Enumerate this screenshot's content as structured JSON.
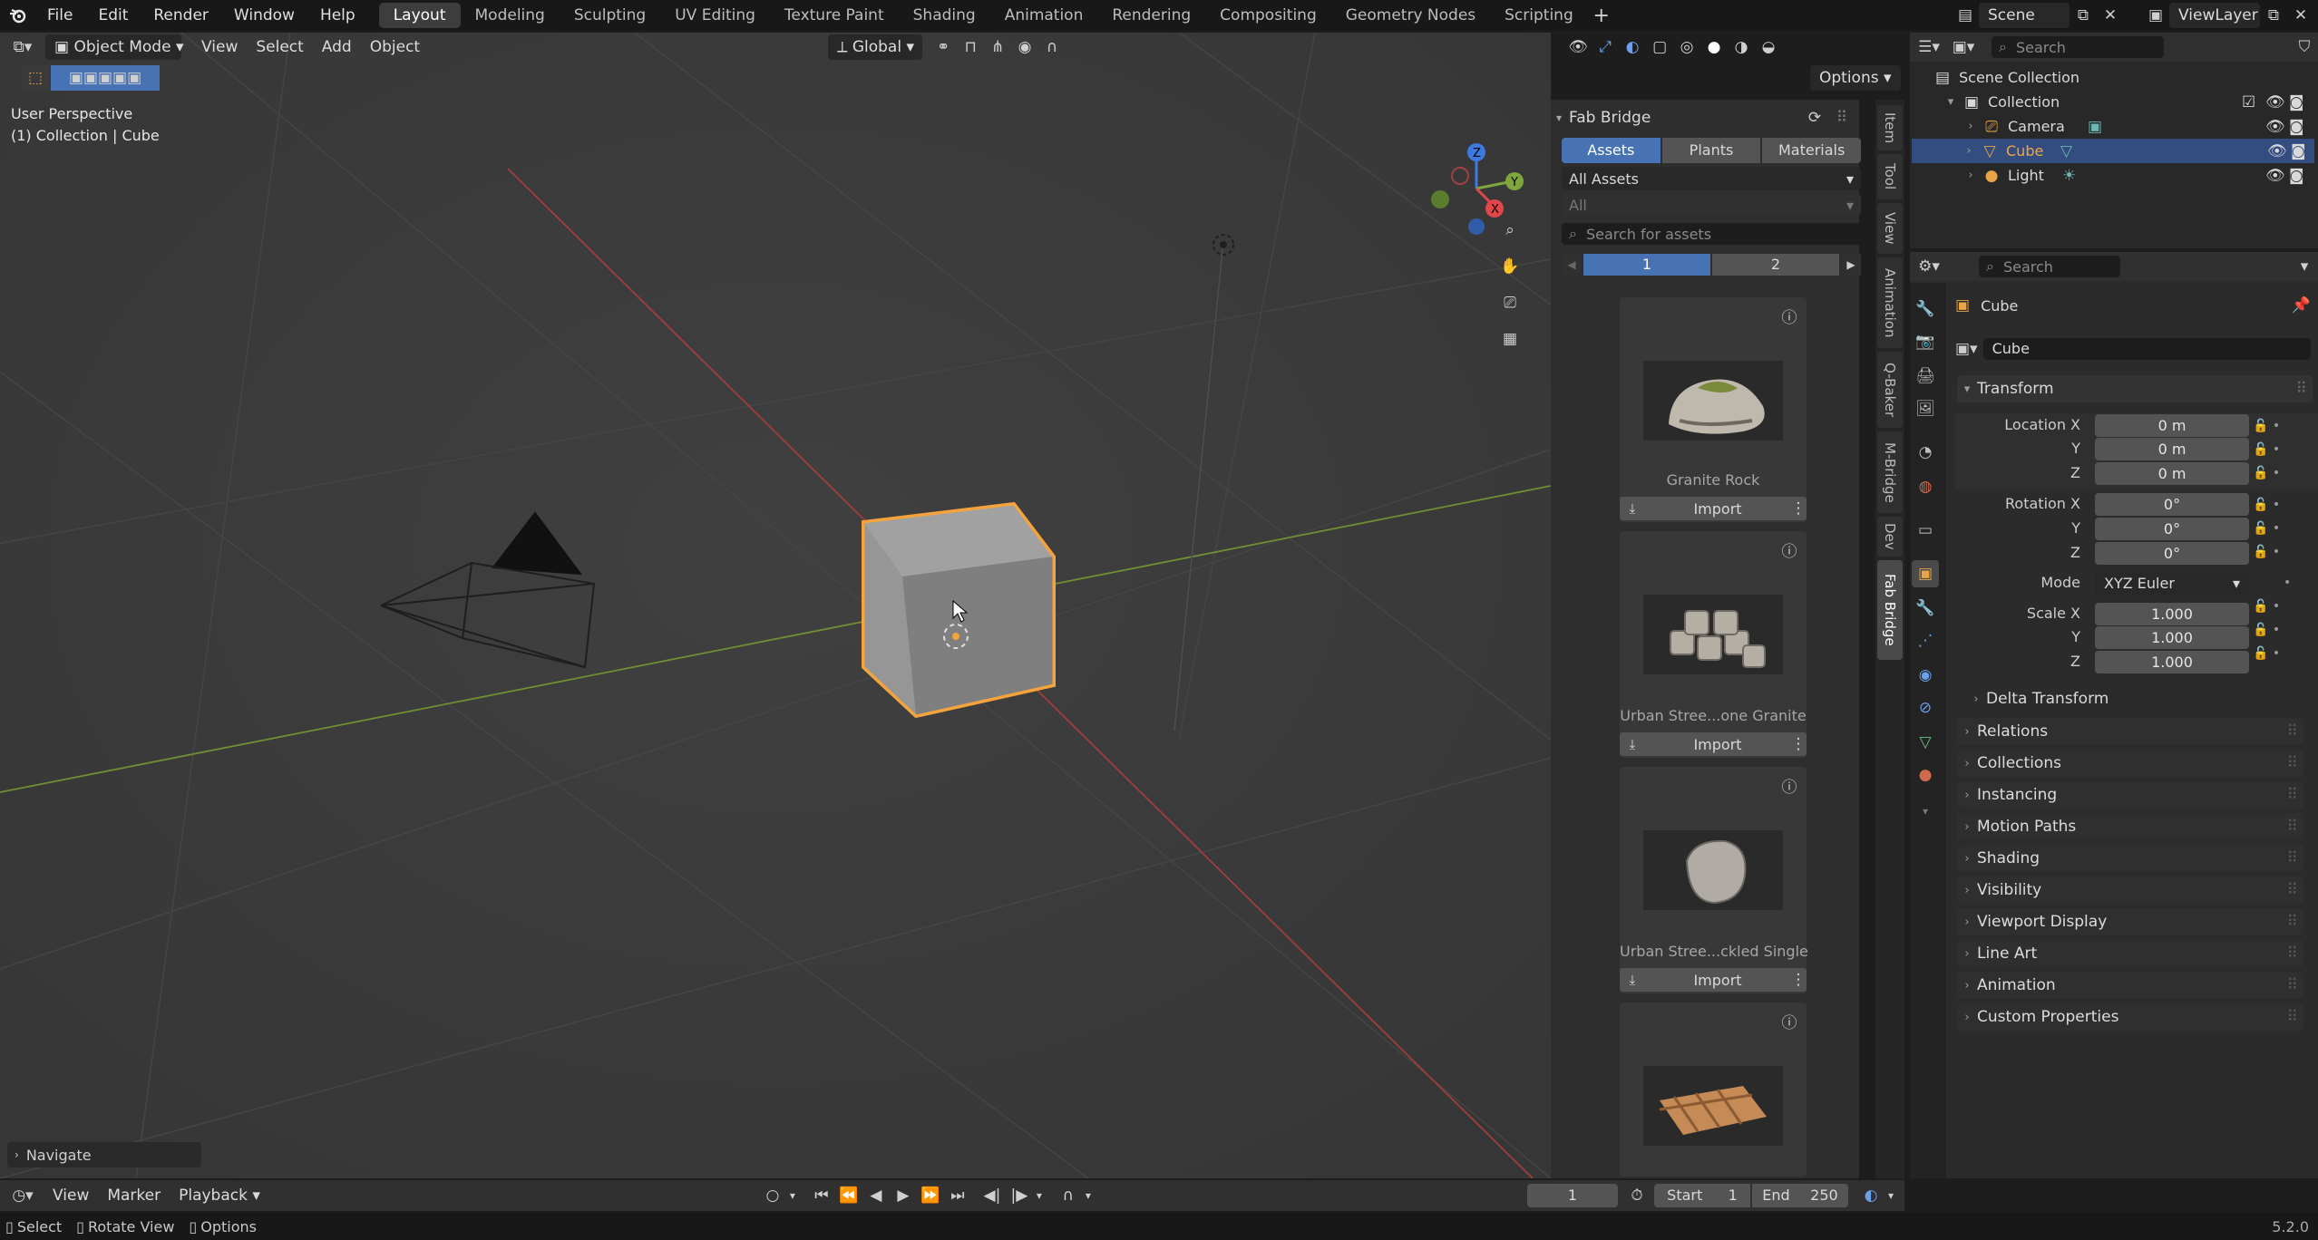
{
  "menu": {
    "items": [
      "File",
      "Edit",
      "Render",
      "Window",
      "Help"
    ]
  },
  "workspaces": [
    "Layout",
    "Modeling",
    "Sculpting",
    "UV Editing",
    "Texture Paint",
    "Shading",
    "Animation",
    "Rendering",
    "Compositing",
    "Geometry Nodes",
    "Scripting"
  ],
  "active_workspace": "Layout",
  "scene": {
    "name": "Scene",
    "view_layer": "ViewLayer"
  },
  "viewport": {
    "mode": "Object Mode",
    "menus": [
      "View",
      "Select",
      "Add",
      "Object"
    ],
    "orientation": "Global",
    "options_label": "Options",
    "info_line1": "User Perspective",
    "info_line2": "(1) Collection | Cube",
    "navigate_label": "Navigate"
  },
  "fab": {
    "title": "Fab Bridge",
    "tabs": [
      "Assets",
      "Plants",
      "Materials"
    ],
    "active_tab": "Assets",
    "filter": "All Assets",
    "subfilter": "All",
    "search_placeholder": "Search for assets",
    "pages": [
      "1",
      "2"
    ],
    "active_page": "1",
    "import_label": "Import",
    "assets": [
      {
        "name": "Granite Rock"
      },
      {
        "name": "Urban Stree...one Granite"
      },
      {
        "name": "Urban Stree...ckled Single"
      },
      {
        "name": ""
      }
    ]
  },
  "side_tabs": [
    "Item",
    "Tool",
    "View",
    "Animation",
    "Q-Baker",
    "M-Bridge",
    "Dev",
    "Fab Bridge"
  ],
  "outliner": {
    "search_placeholder": "Search",
    "root": "Scene Collection",
    "collection": "Collection",
    "objects": [
      "Camera",
      "Cube",
      "Light"
    ],
    "selected": "Cube"
  },
  "properties": {
    "search_placeholder": "Search",
    "object_name": "Cube",
    "data_name": "Cube",
    "transform_label": "Transform",
    "location": {
      "label": "Location X",
      "x": "0 m",
      "y": "0 m",
      "z": "0 m"
    },
    "rotation": {
      "label": "Rotation X",
      "x": "0°",
      "y": "0°",
      "z": "0°"
    },
    "mode_label": "Mode",
    "mode_value": "XYZ Euler",
    "scale": {
      "label": "Scale X",
      "x": "1.000",
      "y": "1.000",
      "z": "1.000"
    },
    "axis_y": "Y",
    "axis_z": "Z",
    "delta": "Delta Transform",
    "panels": [
      "Relations",
      "Collections",
      "Instancing",
      "Motion Paths",
      "Shading",
      "Visibility",
      "Viewport Display",
      "Line Art",
      "Animation",
      "Custom Properties"
    ]
  },
  "timeline": {
    "menus": [
      "View",
      "Marker",
      "Playback"
    ],
    "current_frame": "1",
    "start_label": "Start",
    "start": "1",
    "end_label": "End",
    "end": "250"
  },
  "status": {
    "select": "Select",
    "rotate": "Rotate View",
    "options": "Options",
    "version": "5.2.0"
  },
  "colors": {
    "accent": "#4772b3",
    "selected_outline": "#f5a33c",
    "highlight": "#334d80"
  }
}
